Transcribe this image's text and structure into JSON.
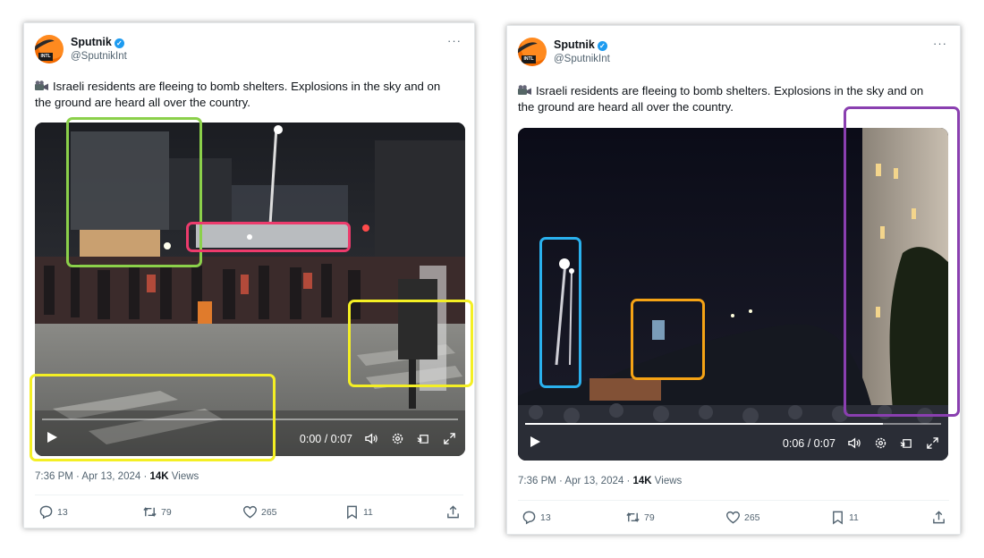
{
  "colors": {
    "green_box": "#8bd04a",
    "pink_box": "#ec3b6c",
    "yellow_box": "#f4ef24",
    "blue_box": "#2ab1ee",
    "orange_box": "#f5a315",
    "purple_box": "#8a3fb0",
    "verified": "#1d9bf0"
  },
  "tweets": [
    {
      "author_name": "Sputnik",
      "author_handle": "@SputnikInt",
      "avatar_text": "INTL",
      "more_label": "···",
      "text": "Israeli residents are fleeing to bomb shelters. Explosions in the sky and on the ground are heard all over the country.",
      "video_time": "0:00 / 0:07",
      "video_progress": 0.0,
      "timestamp": "7:36 PM · Apr 13, 2024 · ",
      "views_count": "14K",
      "views_label": " Views",
      "replies": "13",
      "reposts": "79",
      "likes": "265",
      "bookmarks": "11"
    },
    {
      "author_name": "Sputnik",
      "author_handle": "@SputnikInt",
      "avatar_text": "INTL",
      "more_label": "···",
      "text": "Israeli residents are fleeing to bomb shelters. Explosions in the sky and on the ground are heard all over the country.",
      "video_time": "0:06 / 0:07",
      "video_progress": 0.86,
      "timestamp": "7:36 PM · Apr 13, 2024 · ",
      "views_count": "14K",
      "views_label": " Views",
      "replies": "13",
      "reposts": "79",
      "likes": "265",
      "bookmarks": "11"
    }
  ],
  "icons": {
    "camera": "video-camera-icon",
    "play": "play-icon",
    "volume": "volume-icon",
    "settings": "gear-icon",
    "pip": "picture-in-picture-icon",
    "fullscreen": "fullscreen-icon",
    "reply": "reply-icon",
    "repost": "repost-icon",
    "like": "heart-icon",
    "bookmark": "bookmark-icon",
    "share": "share-icon"
  }
}
